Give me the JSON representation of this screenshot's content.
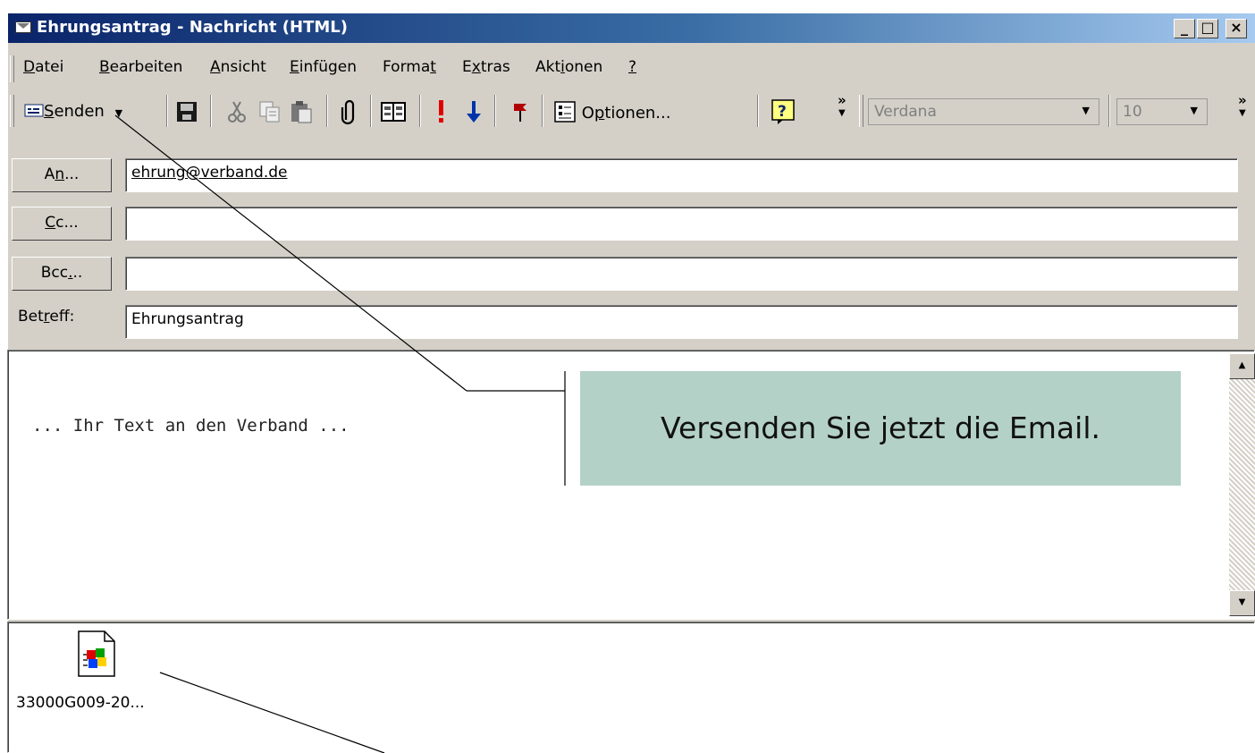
{
  "window": {
    "title": "Ehrungsantrag - Nachricht (HTML)",
    "buttons": {
      "minimize": "_",
      "maximize": "□",
      "close": "×"
    }
  },
  "menu": [
    {
      "pre": "",
      "key": "D",
      "post": "atei"
    },
    {
      "pre": "",
      "key": "B",
      "post": "earbeiten"
    },
    {
      "pre": "",
      "key": "A",
      "post": "nsicht"
    },
    {
      "pre": "",
      "key": "E",
      "post": "infügen"
    },
    {
      "pre": "Forma",
      "key": "t",
      "post": ""
    },
    {
      "pre": "E",
      "key": "x",
      "post": "tras"
    },
    {
      "pre": "Akt",
      "key": "i",
      "post": "onen"
    },
    {
      "pre": "",
      "key": "?",
      "post": ""
    }
  ],
  "toolbar": {
    "send_pre": "",
    "send_key": "S",
    "send_post": "enden",
    "options_pre": "O",
    "options_key": "p",
    "options_post": "tionen...",
    "overflow": "»",
    "font": "Verdana",
    "size": "10",
    "icons": [
      "save-icon",
      "cut-icon",
      "copy-icon",
      "paste-icon",
      "attach-icon",
      "address-book-icon",
      "high-importance-icon",
      "low-importance-icon",
      "flag-icon",
      "options-icon",
      "help-icon"
    ]
  },
  "fields": {
    "to_button": {
      "pre": "A",
      "key": "n",
      "post": "..."
    },
    "cc_button": {
      "pre": "",
      "key": "C",
      "post": "c..."
    },
    "bcc_button": {
      "pre": "Bcc",
      "key": ".",
      "post": ".."
    },
    "subject_label": {
      "pre": "Bet",
      "key": "r",
      "post": "eff:"
    },
    "to_value": "ehrung@verband.de",
    "cc_value": "",
    "bcc_value": "",
    "subject_value": "Ehrungsantrag"
  },
  "body": {
    "text": "... Ihr Text an den Verband ..."
  },
  "attachment": {
    "name": "33000G009-20..."
  },
  "callout": {
    "text": "Versenden Sie jetzt die Email."
  },
  "colors": {
    "callout": "#b4d1c8",
    "title_start": "#0a246a",
    "title_end": "#a6caf0"
  }
}
